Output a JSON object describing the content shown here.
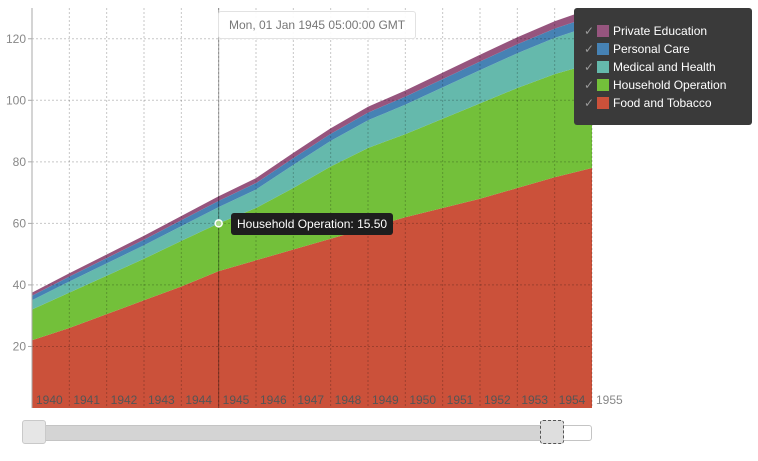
{
  "chart_data": {
    "type": "area",
    "stacked": true,
    "x": [
      1940,
      1941,
      1942,
      1943,
      1944,
      1945,
      1946,
      1947,
      1948,
      1949,
      1950,
      1951,
      1952,
      1953,
      1954,
      1955
    ],
    "x_tick_labels": [
      "1940",
      "1941",
      "1942",
      "1943",
      "1944",
      "1945",
      "1946",
      "1947",
      "1948",
      "1949",
      "1950",
      "1951",
      "1952",
      "1953",
      "1954",
      "1955"
    ],
    "y_tick_labels": [
      "20",
      "40",
      "60",
      "80",
      "100",
      "120"
    ],
    "xlim": [
      1940,
      1955
    ],
    "ylim": [
      0,
      130
    ],
    "y_ticks": [
      20,
      40,
      60,
      80,
      100,
      120
    ],
    "grid": true,
    "legend_position": "top-right",
    "series": [
      {
        "name": "Food and Tobacco",
        "color": "#cb513a",
        "values": [
          22,
          26,
          30.5,
          35,
          39.5,
          44.5,
          48,
          51.5,
          55,
          58.5,
          62,
          65,
          68,
          71.5,
          75,
          78
        ]
      },
      {
        "name": "Household Operation",
        "color": "#73c03a",
        "values": [
          10,
          11.5,
          12.5,
          13.5,
          14.8,
          15.5,
          17,
          20,
          23.5,
          26,
          27,
          29,
          31,
          32.5,
          33.5,
          34
        ]
      },
      {
        "name": "Medical and Health",
        "color": "#65b9ac",
        "values": [
          3.0,
          3.6,
          4.0,
          4.4,
          4.8,
          5.3,
          6.0,
          7.5,
          8.3,
          9.0,
          9.6,
          10.2,
          10.8,
          11.3,
          11.8,
          12.3
        ]
      },
      {
        "name": "Personal Care",
        "color": "#4682b4",
        "values": [
          1.5,
          1.6,
          1.7,
          1.8,
          1.9,
          2.0,
          2.1,
          2.2,
          2.3,
          2.5,
          2.6,
          2.7,
          2.8,
          2.9,
          3.0,
          3.1
        ]
      },
      {
        "name": "Private Education",
        "color": "#96557e",
        "values": [
          1.0,
          1.1,
          1.2,
          1.3,
          1.4,
          1.5,
          1.6,
          1.7,
          1.8,
          1.9,
          2.0,
          2.1,
          2.2,
          2.3,
          2.4,
          2.5
        ]
      }
    ],
    "highlight": {
      "series": "Household Operation",
      "x": 1945
    }
  },
  "hover": {
    "date_text": "Mon, 01 Jan 1945 05:00:00 GMT",
    "tooltip_text": "Household Operation: 15.50"
  },
  "legend": {
    "check_icon": "check-icon",
    "items": [
      {
        "label": "Private Education",
        "color": "#96557e"
      },
      {
        "label": "Personal Care",
        "color": "#4682b4"
      },
      {
        "label": "Medical and Health",
        "color": "#65b9ac"
      },
      {
        "label": "Household Operation",
        "color": "#73c03a"
      },
      {
        "label": "Food and Tobacco",
        "color": "#cb513a"
      }
    ]
  },
  "range_slider": {
    "min": 1940,
    "max": 1955,
    "start": 1940,
    "end": 1954
  }
}
